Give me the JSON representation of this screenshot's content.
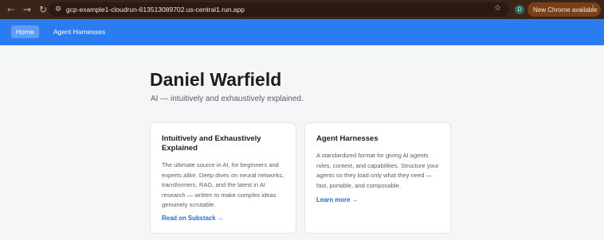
{
  "browser": {
    "back_icon": "←",
    "forward_icon": "→",
    "reload_icon": "↻",
    "tune_icon": "⚙",
    "url": "gcp-example1-cloudrun-613513089702.us-central1.run.app",
    "star_icon": "☆",
    "profile_initial": "D",
    "update_label": "New Chrome available",
    "menu_icon": "⋮"
  },
  "nav": {
    "home_label": "Home",
    "harnesses_label": "Agent Harnesses"
  },
  "hero": {
    "title": "Daniel Warfield",
    "tagline": "AI — intuitively and exhaustively explained."
  },
  "cards": [
    {
      "title": "Intuitively and Exhaustively Explained",
      "description": "The ultimate source in AI, for beginners and experts alike. Deep dives on neural networks, transformers, RAG, and the latest in AI research — written to make complex ideas genuinely scrutable.",
      "link_label": "Read on Substack →"
    },
    {
      "title": "Agent Harnesses",
      "description": "A standardized format for giving AI agents roles, context, and capabilities. Structure your agents so they load only what they need — fast, portable, and composable.",
      "link_label": "Learn more →"
    }
  ],
  "colors": {
    "nav_blue": "#2b7cf0",
    "link_blue": "#1f6fd1",
    "chrome_bg": "#3a2418"
  }
}
